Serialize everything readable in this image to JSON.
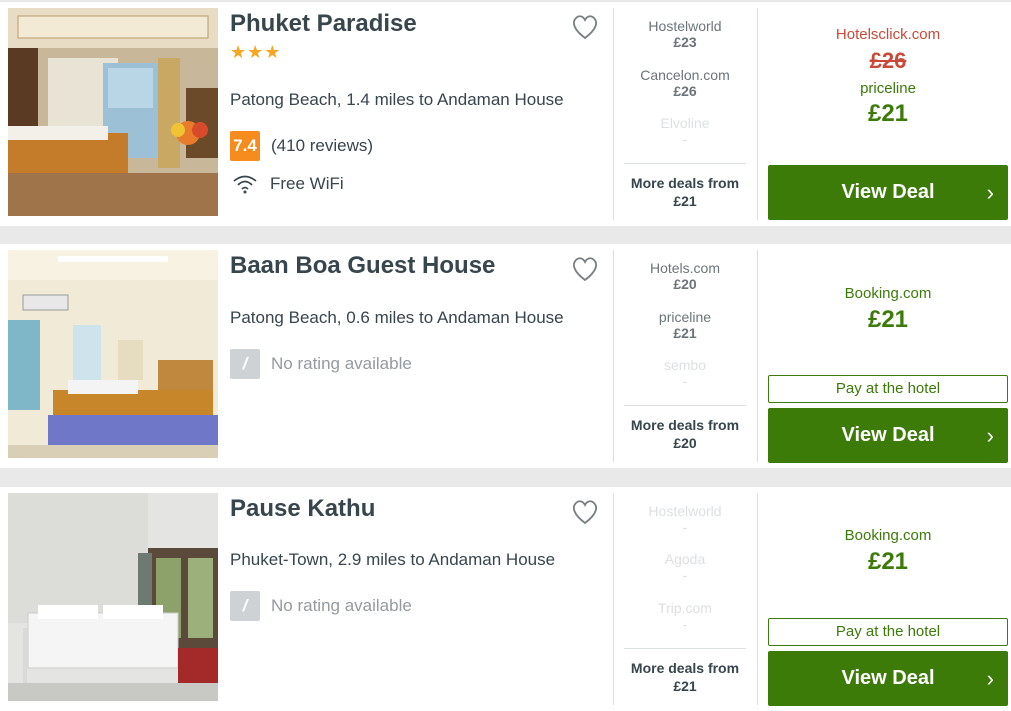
{
  "colors": {
    "accent_green": "#3d7b08",
    "score_orange": "#f68b1e",
    "strike_red": "#c94a3a",
    "star_gold": "#f5a623"
  },
  "hotels": [
    {
      "name": "Phuket Paradise",
      "stars": "★★★",
      "location": "Patong Beach, 1.4 miles to Andaman House",
      "rating_score": "7.4",
      "rating_text": "(410 reviews)",
      "amenity": "Free WiFi",
      "deals": [
        {
          "provider": "Hostelworld",
          "price": "£23"
        },
        {
          "provider": "Cancelon.com",
          "price": "£26"
        },
        {
          "provider": "Elvoline",
          "price": "-"
        }
      ],
      "more_deals_label": "More deals from",
      "more_deals_price": "£21",
      "best_site": "Hotelsclick.com",
      "best_old_price": "£26",
      "best_alt_site": "priceline",
      "best_price": "£21",
      "view_deal_label": "View Deal"
    },
    {
      "name": "Baan Boa Guest House",
      "location": "Patong Beach, 0.6 miles to Andaman House",
      "rating_score": "/",
      "rating_text": "No rating available",
      "deals": [
        {
          "provider": "Hotels.com",
          "price": "£20"
        },
        {
          "provider": "priceline",
          "price": "£21"
        },
        {
          "provider": "sembo",
          "price": "-"
        }
      ],
      "more_deals_label": "More deals from",
      "more_deals_price": "£20",
      "best_site": "Booking.com",
      "best_price": "£21",
      "pay_label": "Pay at the hotel",
      "view_deal_label": "View Deal"
    },
    {
      "name": "Pause Kathu",
      "location": "Phuket-Town, 2.9 miles to Andaman House",
      "rating_score": "/",
      "rating_text": "No rating available",
      "deals": [
        {
          "provider": "Hostelworld",
          "price": "-"
        },
        {
          "provider": "Agoda",
          "price": "-"
        },
        {
          "provider": "Trip.com",
          "price": "-"
        }
      ],
      "more_deals_label": "More deals from",
      "more_deals_price": "£21",
      "best_site": "Booking.com",
      "best_price": "£21",
      "pay_label": "Pay at the hotel",
      "view_deal_label": "View Deal"
    }
  ]
}
